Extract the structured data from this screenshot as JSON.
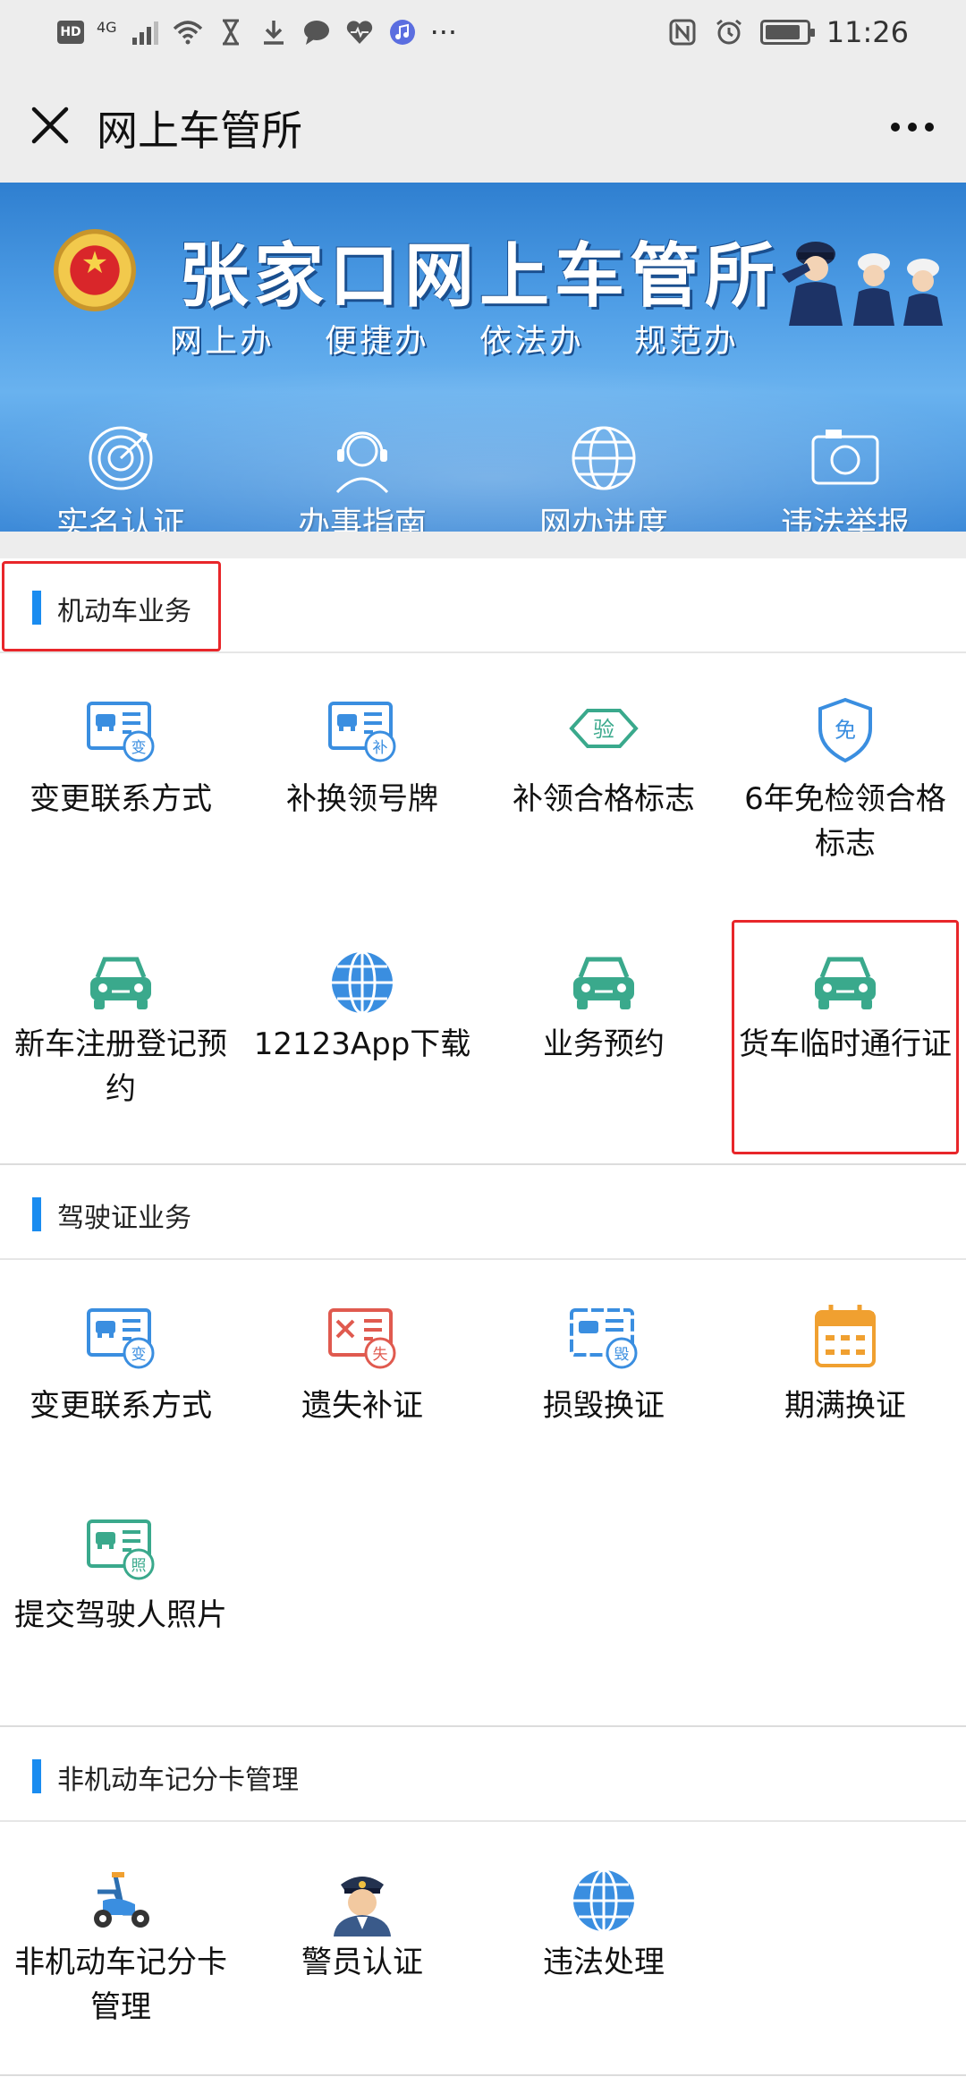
{
  "status_bar": {
    "left_badges": [
      "HD",
      "4G"
    ],
    "time": "11:26"
  },
  "title_bar": {
    "title": "网上车管所",
    "close_icon": "close-icon",
    "more_icon": "more-icon"
  },
  "banner": {
    "title": "张家口网上车管所",
    "slogans": [
      "网上办",
      "便捷办",
      "依法办",
      "规范办"
    ],
    "quick_links": [
      {
        "label": "实名认证",
        "icon": "target-icon"
      },
      {
        "label": "办事指南",
        "icon": "headset-icon"
      },
      {
        "label": "网办进度",
        "icon": "globe-icon"
      },
      {
        "label": "违法举报",
        "icon": "camera-icon"
      }
    ]
  },
  "sections": [
    {
      "title": "机动车业务",
      "items": [
        {
          "label": "变更联系方式",
          "icon": "license-card-change-icon",
          "badge": "变"
        },
        {
          "label": "补换领号牌",
          "icon": "license-card-reissue-icon",
          "badge": "补"
        },
        {
          "label": "补领合格标志",
          "icon": "inspection-badge-icon",
          "badge": "验"
        },
        {
          "label": "6年免检领合格标志",
          "icon": "shield-exempt-icon",
          "badge": "免"
        },
        {
          "label": "新车注册登记预约",
          "icon": "car-icon"
        },
        {
          "label": "12123App下载",
          "icon": "globe-icon"
        },
        {
          "label": "业务预约",
          "icon": "car-icon"
        },
        {
          "label": "货车临时通行证",
          "icon": "car-icon"
        }
      ]
    },
    {
      "title": "驾驶证业务",
      "items": [
        {
          "label": "变更联系方式",
          "icon": "license-card-change-icon",
          "badge": "变"
        },
        {
          "label": "遗失补证",
          "icon": "license-card-lost-icon",
          "badge": "失"
        },
        {
          "label": "损毁换证",
          "icon": "license-card-damaged-icon",
          "badge": "毁"
        },
        {
          "label": "期满换证",
          "icon": "calendar-icon"
        },
        {
          "label": "提交驾驶人照片",
          "icon": "license-card-photo-icon",
          "badge": "照"
        }
      ]
    },
    {
      "title": "非机动车记分卡管理",
      "items": [
        {
          "label": "非机动车记分卡管理",
          "icon": "scooter-icon"
        },
        {
          "label": "警员认证",
          "icon": "police-officer-icon"
        },
        {
          "label": "违法处理",
          "icon": "globe-icon"
        }
      ]
    }
  ],
  "colors": {
    "blue": "#3a8ee0",
    "teal": "#3aa98c",
    "red": "#e05a4f",
    "orange": "#f0a030",
    "highlight": "#e8262a",
    "section_bar": "#1a8cf0"
  }
}
